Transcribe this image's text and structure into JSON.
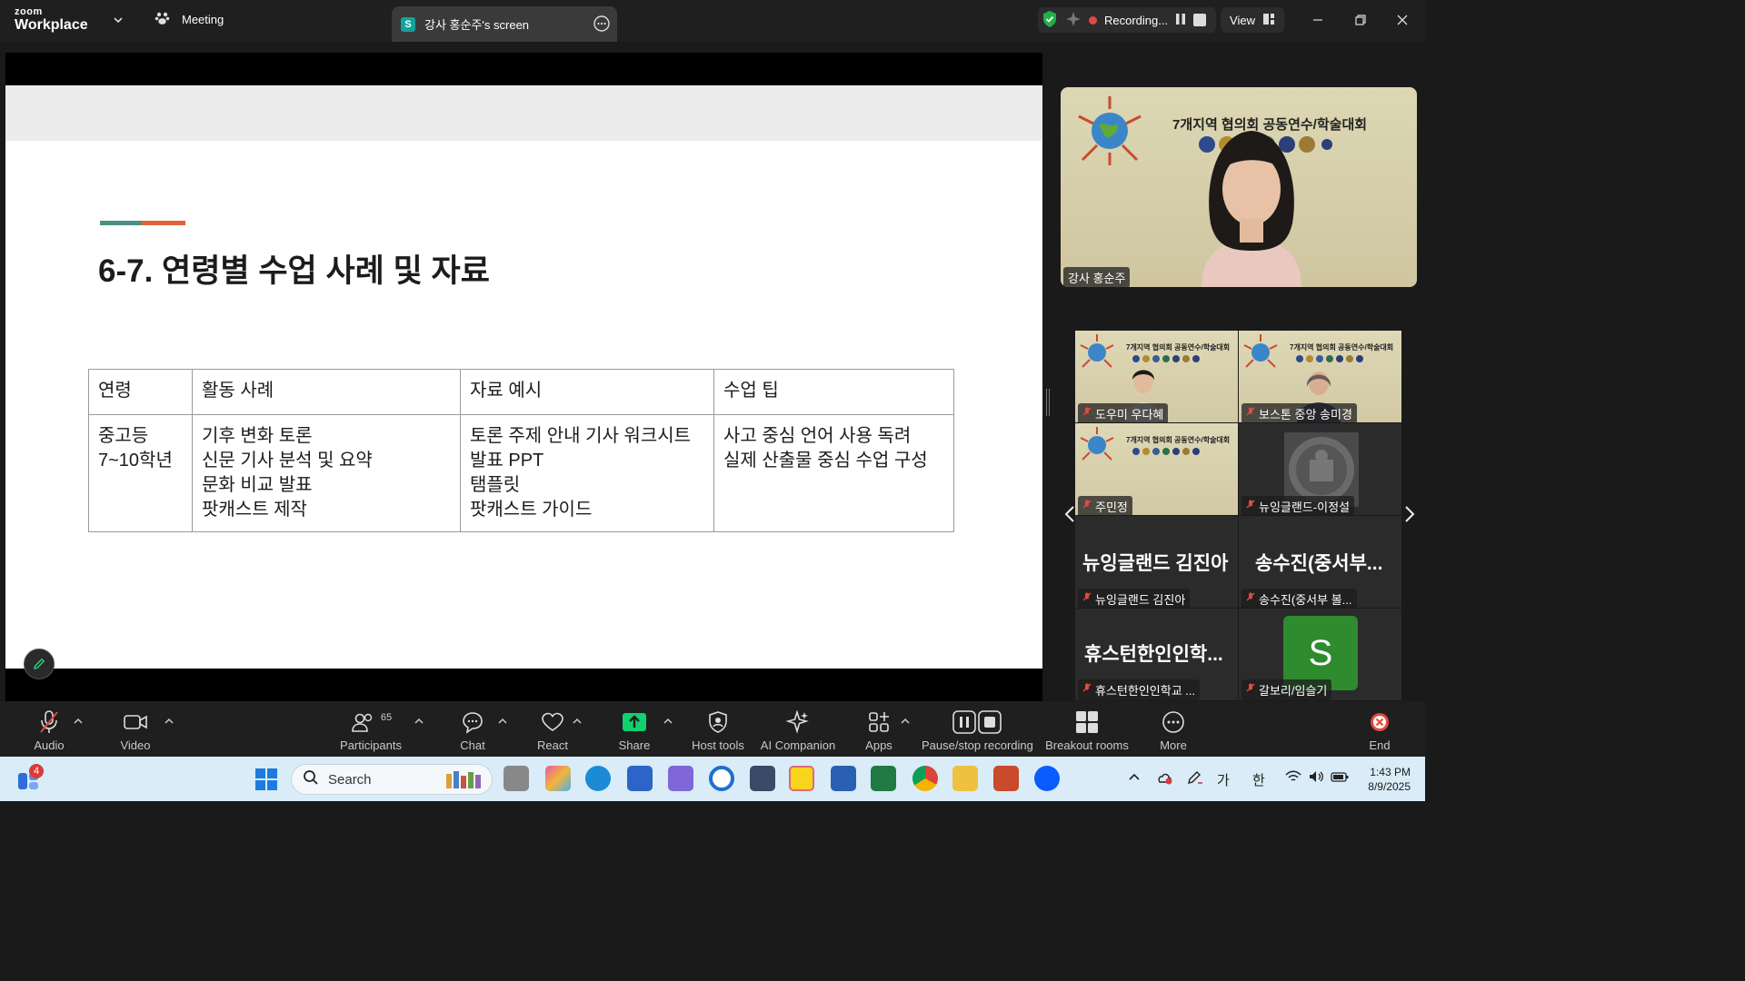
{
  "titlebar": {
    "brand_small": "zoom",
    "brand_big": "Workplace",
    "meeting_label": "Meeting",
    "screen_tab_badge": "S",
    "screen_tab_label": "강사 홍순주's screen",
    "recording_label": "Recording...",
    "view_label": "View"
  },
  "slide": {
    "title": "6-7. 연령별 수업 사례 및 자료",
    "headers": [
      "연령",
      "활동 사례",
      "자료 예시",
      "수업 팁"
    ],
    "row": {
      "age": [
        "중고등",
        "7~10학년"
      ],
      "activities": [
        "기후 변화 토론",
        "신문 기사 분석 및 요약",
        "문화 비교 발표",
        "팟캐스트 제작"
      ],
      "materials": [
        "토론 주제 안내 기사 워크시트",
        "발표 PPT",
        "탬플릿",
        "팟캐스트 가이드"
      ],
      "tips": [
        "사고 중심 언어 사용 독려",
        "실제 산출물 중심 수업 구성"
      ]
    },
    "accent_colors": [
      "#4a8f84",
      "#e0643b"
    ]
  },
  "speaker": {
    "banner": "7개지역 협의회 공동연수/학술대회",
    "name": "강사 홍순주"
  },
  "gallery": {
    "banner": "7개지역 협의회 공동연수/학술대회",
    "tiles": [
      {
        "name": "도우미 우다혜"
      },
      {
        "name": "보스톤 중앙 송미경"
      },
      {
        "name": "주민정"
      },
      {
        "name": "뉴잉글랜드-이정설"
      },
      {
        "display": "뉴잉글랜드 김진아",
        "name": "뉴잉글랜드 김진아"
      },
      {
        "display": "송수진(중서부...",
        "name": "송수진(중서부 볼..."
      },
      {
        "display": "휴스턴한인인학...",
        "name": "휴스턴한인인학교 ..."
      },
      {
        "avatar_letter": "S",
        "name": "갈보리/임슬기"
      }
    ]
  },
  "toolbar": {
    "audio": "Audio",
    "video": "Video",
    "participants": "Participants",
    "participants_count": "65",
    "chat": "Chat",
    "react": "React",
    "share": "Share",
    "host_tools": "Host tools",
    "ai_companion": "AI Companion",
    "apps": "Apps",
    "pause_recording": "Pause/stop recording",
    "breakout": "Breakout rooms",
    "more": "More",
    "end": "End"
  },
  "taskbar": {
    "widget_badge": "4",
    "search_placeholder": "Search",
    "ime_1": "가",
    "ime_2": "한",
    "time": "1:43 PM",
    "date": "8/9/2025"
  },
  "colors": {
    "zoom_blue": "#0b5cff",
    "share_green": "#0fd16e",
    "recording_red": "#e5483f",
    "end_red": "#e5483f",
    "taskbar_bg": "#d9ecf7"
  }
}
